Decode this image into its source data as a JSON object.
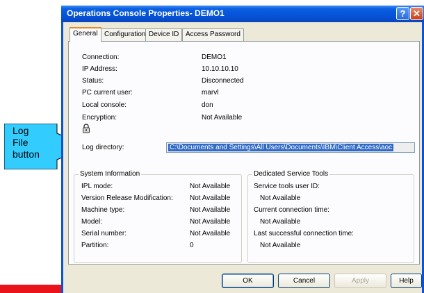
{
  "callout": {
    "line1": "Log",
    "line2": "File",
    "line3": "button"
  },
  "window": {
    "title": "Operations Console Properties- DEMO1",
    "help_glyph": "?",
    "close_glyph": "✕"
  },
  "tabs": [
    {
      "label": "General",
      "active": true
    },
    {
      "label": "Configuration",
      "active": false
    },
    {
      "label": "Device ID",
      "active": false
    },
    {
      "label": "Access Password",
      "active": false
    }
  ],
  "general": {
    "rows": [
      {
        "label": "Connection:",
        "value": "DEMO1"
      },
      {
        "label": "IP Address:",
        "value": "10.10.10.10"
      },
      {
        "label": "Status:",
        "value": "Disconnected"
      },
      {
        "label": "PC current user:",
        "value": "marvl"
      },
      {
        "label": "Local console:",
        "value": "don"
      },
      {
        "label": "Encryption:",
        "value": "Not Available"
      }
    ],
    "log_label": "Log directory:",
    "log_path": "C:\\Documents and Settings\\All Users\\Documents\\IBM\\Client Access\\aoc"
  },
  "system_info": {
    "title": "System Information",
    "rows": [
      {
        "label": "IPL mode:",
        "value": "Not Available"
      },
      {
        "label": "Version Release Modification:",
        "value": "Not Available"
      },
      {
        "label": "Machine type:",
        "value": "Not Available"
      },
      {
        "label": "Model:",
        "value": "Not Available"
      },
      {
        "label": "Serial number:",
        "value": "Not Available"
      },
      {
        "label": "Partition:",
        "value": "0"
      }
    ]
  },
  "dst": {
    "title": "Dedicated Service Tools",
    "items": [
      {
        "label": "Service tools user ID:",
        "value": "Not Available"
      },
      {
        "label": "Current connection time:",
        "value": "Not Available"
      },
      {
        "label": "Last successful connection time:",
        "value": "Not Available"
      }
    ]
  },
  "buttons": {
    "ok": "OK",
    "cancel": "Cancel",
    "apply": "Apply",
    "help": "Help"
  },
  "colors": {
    "titlebar": "#0550d6",
    "selection": "#316ac5",
    "callout_fill": "#33ccff",
    "accent_red": "#e8141a"
  }
}
